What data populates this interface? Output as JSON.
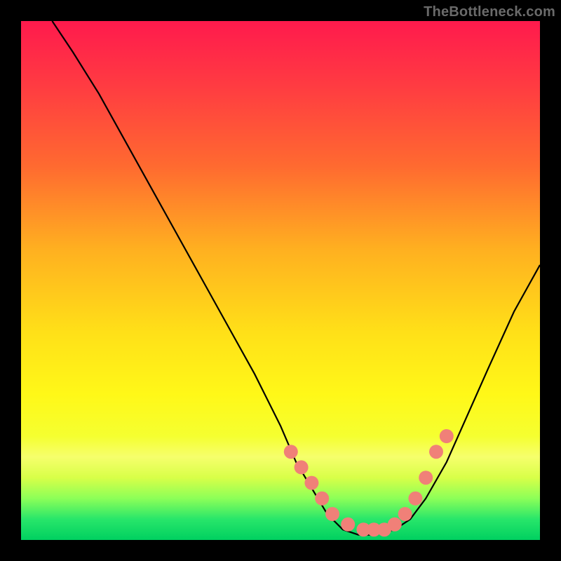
{
  "watermark": "TheBottleneck.com",
  "chart_data": {
    "type": "line",
    "title": "",
    "xlabel": "",
    "ylabel": "",
    "xlim": [
      0,
      100
    ],
    "ylim": [
      0,
      100
    ],
    "grid": false,
    "legend": false,
    "series": [
      {
        "name": "curve",
        "x": [
          6,
          10,
          15,
          20,
          25,
          30,
          35,
          40,
          45,
          50,
          53,
          56,
          59,
          62,
          65,
          68,
          72,
          75,
          78,
          82,
          86,
          90,
          95,
          100
        ],
        "y": [
          100,
          94,
          86,
          77,
          68,
          59,
          50,
          41,
          32,
          22,
          15,
          10,
          5,
          2,
          1,
          1,
          2,
          4,
          8,
          15,
          24,
          33,
          44,
          53
        ],
        "color": "#000000"
      }
    ],
    "markers": [
      {
        "name": "dots",
        "x": [
          52,
          54,
          56,
          58,
          60,
          63,
          66,
          68,
          70,
          72,
          74,
          76,
          78,
          80,
          82
        ],
        "y": [
          17,
          14,
          11,
          8,
          5,
          3,
          2,
          2,
          2,
          3,
          5,
          8,
          12,
          17,
          20
        ],
        "color": "#f08078",
        "size": 10
      }
    ]
  },
  "colors": {
    "background": "#000000",
    "curve": "#000000",
    "marker": "#f08078"
  }
}
